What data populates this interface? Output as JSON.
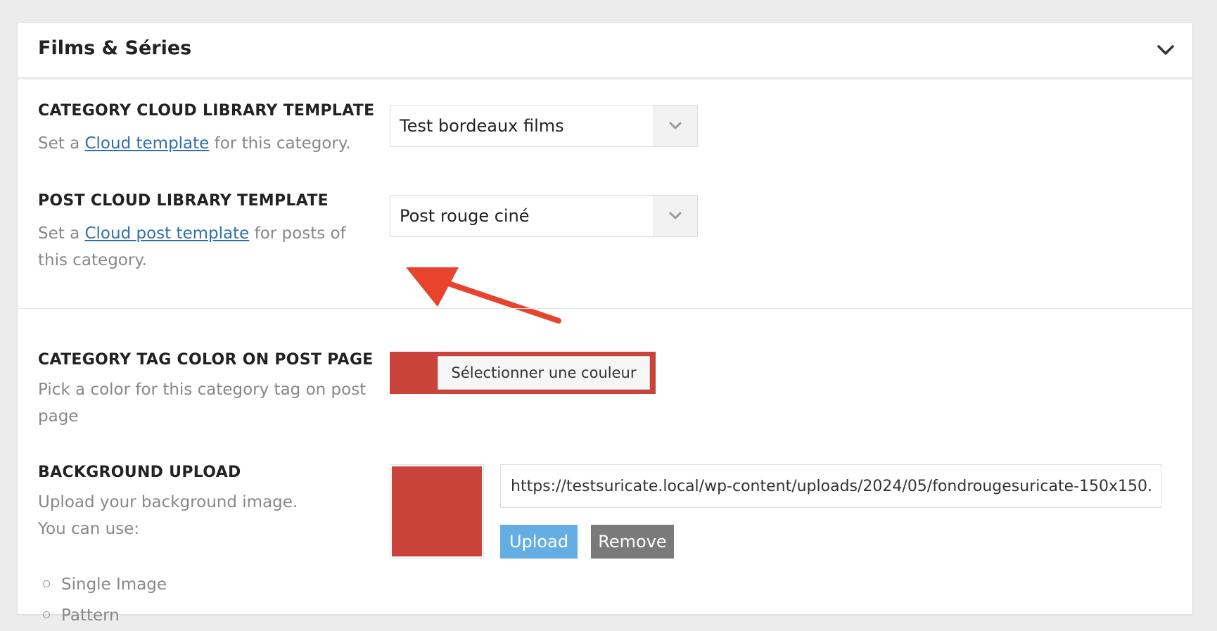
{
  "panel": {
    "title": "Films & Séries"
  },
  "category_template": {
    "label": "CATEGORY CLOUD LIBRARY TEMPLATE",
    "desc_prefix": "Set a ",
    "desc_link": "Cloud template",
    "desc_suffix": " for this category.",
    "selected": "Test bordeaux films"
  },
  "post_template": {
    "label": "POST CLOUD LIBRARY TEMPLATE",
    "desc_prefix": "Set a ",
    "desc_link": "Cloud post template",
    "desc_suffix": " for posts of this category.",
    "selected": "Post rouge ciné"
  },
  "tag_color": {
    "label": "CATEGORY TAG COLOR ON POST PAGE",
    "desc": "Pick a color for this category tag on post page",
    "button_label": "Sélectionner une couleur",
    "color": "#c9433b"
  },
  "background": {
    "label": "BACKGROUND UPLOAD",
    "desc_line1": "Upload your background image.",
    "desc_line2": "You can use:",
    "url": "https://testsuricate.local/wp-content/uploads/2024/05/fondrougesuricate-150x150.png",
    "upload_label": "Upload",
    "remove_label": "Remove",
    "options": [
      "Single Image",
      "Pattern"
    ],
    "preview_color": "#c9433b"
  },
  "annotation": {
    "arrow_color": "#e8432c"
  },
  "icons": {
    "toggle": "chevron-down-icon",
    "select": "chevron-down-icon"
  }
}
